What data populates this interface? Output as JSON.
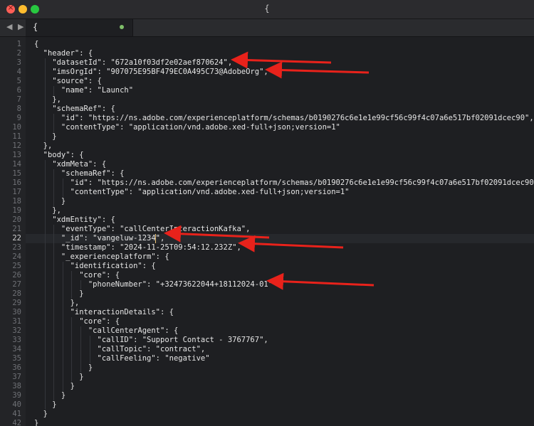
{
  "window": {
    "title": "{"
  },
  "tab": {
    "label": "{"
  },
  "nav": {
    "arrows": "◀ ▶"
  },
  "colors": {
    "accent_arrow": "#e8221b",
    "modified_dot": "#7fbf6a"
  },
  "editor": {
    "current_line": 22,
    "lines": [
      "{",
      "  \"header\": {",
      "    \"datasetId\": \"672a10f03df2e02aef870624\",",
      "    \"imsOrgId\": \"907075E95BF479EC0A495C73@AdobeOrg\",",
      "    \"source\": {",
      "      \"name\": \"Launch\"",
      "    },",
      "    \"schemaRef\": {",
      "      \"id\": \"https://ns.adobe.com/experienceplatform/schemas/b0190276c6e1e1e99cf56c99f4c07a6e517bf02091dcec90\",",
      "      \"contentType\": \"application/vnd.adobe.xed-full+json;version=1\"",
      "    }",
      "  },",
      "  \"body\": {",
      "    \"xdmMeta\": {",
      "      \"schemaRef\": {",
      "        \"id\": \"https://ns.adobe.com/experienceplatform/schemas/b0190276c6e1e1e99cf56c99f4c07a6e517bf02091dcec90\",",
      "        \"contentType\": \"application/vnd.adobe.xed-full+json;version=1\"",
      "      }",
      "    },",
      "    \"xdmEntity\": {",
      "      \"eventType\": \"callCenterInteractionKafka\",",
      "      \"_id\": \"vangeluw-1234\",",
      "      \"timestamp\": \"2024-11-25T09:54:12.232Z\",",
      "      \"_experienceplatform\": {",
      "        \"identification\": {",
      "          \"core\": {",
      "            \"phoneNumber\": \"+32473622044+18112024-01\"",
      "          }",
      "        },",
      "        \"interactionDetails\": {",
      "          \"core\": {",
      "            \"callCenterAgent\": {",
      "              \"callID\": \"Support Contact - 3767767\",",
      "              \"callTopic\": \"contract\",",
      "              \"callFeeling\": \"negative\"",
      "            }",
      "          }",
      "        }",
      "      }",
      "    }",
      "  }",
      "}"
    ]
  }
}
